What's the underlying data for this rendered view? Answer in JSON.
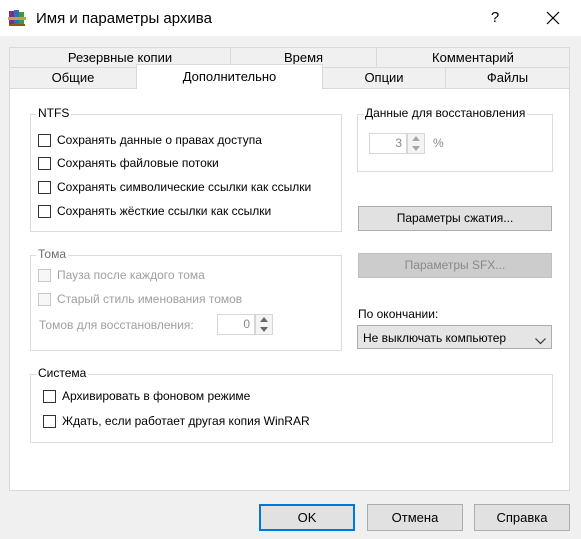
{
  "window": {
    "title": "Имя и параметры архива",
    "help_glyph": "?"
  },
  "tabs": {
    "row_top": [
      "Резервные копии",
      "Время",
      "Комментарий"
    ],
    "row_bottom": [
      "Общие",
      "Дополнительно",
      "Опции",
      "Файлы"
    ],
    "active": "Дополнительно"
  },
  "ntfs": {
    "legend": "NTFS",
    "options": [
      {
        "label": "Сохранять данные о правах доступа",
        "checked": false
      },
      {
        "label": "Сохранять файловые потоки",
        "checked": false
      },
      {
        "label": "Сохранять символические ссылки как ссылки",
        "checked": false
      },
      {
        "label": "Сохранять жёсткие ссылки как ссылки",
        "checked": false
      }
    ]
  },
  "recovery": {
    "legend": "Данные для восстановления",
    "value": "3",
    "unit": "%"
  },
  "buttons": {
    "compression": "Параметры сжатия...",
    "sfx": "Параметры SFX...",
    "ok": "OK",
    "cancel": "Отмена",
    "help": "Справка"
  },
  "volumes": {
    "legend": "Тома",
    "options": [
      {
        "label": "Пауза после каждого тома",
        "checked": false
      },
      {
        "label": "Старый стиль именования томов",
        "checked": false
      }
    ],
    "recovery_label": "Томов для восстановления:",
    "recovery_value": "0"
  },
  "on_finish": {
    "label": "По окончании:",
    "selected": "Не выключать компьютер"
  },
  "system": {
    "legend": "Система",
    "options": [
      {
        "label": "Архивировать в фоновом режиме",
        "checked": false
      },
      {
        "label": "Ждать, если работает другая копия WinRAR",
        "checked": false
      }
    ]
  },
  "icons": {
    "app": "winrar-books-icon",
    "close": "close-icon",
    "spin": "spin-arrows-icon",
    "dropdown": "chevron-down-icon"
  },
  "colors": {
    "accent": "#0078d7",
    "panel": "#ffffff",
    "dialog": "#f0f0f0"
  }
}
